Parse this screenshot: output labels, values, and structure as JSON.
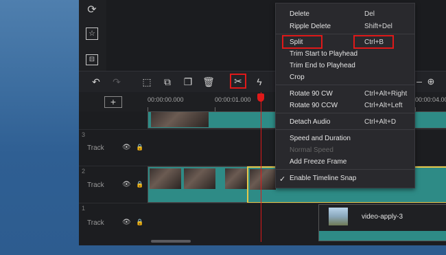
{
  "left_panel": {
    "icons": [
      "refresh-icon",
      "sticker-icon",
      "layout-icon"
    ]
  },
  "toolbar": {
    "buttons": [
      "undo-icon",
      "redo-icon",
      "crop-frame-icon",
      "copy-icon",
      "duplicate-icon",
      "delete-icon",
      "scissors-icon",
      "flash-icon",
      "zoom-in-icon"
    ]
  },
  "ruler": {
    "add_label": "+",
    "times": [
      "00:00:00.000",
      "00:00:01.000",
      "00:00:04.00"
    ]
  },
  "tracks": [
    {
      "number": "3",
      "label": "Track"
    },
    {
      "number": "2",
      "label": "Track"
    },
    {
      "number": "1",
      "label": "Track"
    }
  ],
  "clip_names": {
    "track1": "video-apply-3"
  },
  "context_menu": {
    "items": [
      {
        "label": "Delete",
        "shortcut": "Del"
      },
      {
        "label": "Ripple Delete",
        "shortcut": "Shift+Del"
      },
      {
        "label": "Split",
        "shortcut": "Ctrl+B"
      },
      {
        "label": "Trim Start to Playhead",
        "shortcut": ""
      },
      {
        "label": "Trim End to Playhead",
        "shortcut": ""
      },
      {
        "label": "Crop",
        "shortcut": ""
      },
      {
        "label": "Rotate 90 CW",
        "shortcut": "Ctrl+Alt+Right"
      },
      {
        "label": "Rotate 90 CCW",
        "shortcut": "Ctrl+Alt+Left"
      },
      {
        "label": "Detach Audio",
        "shortcut": "Ctrl+Alt+D"
      },
      {
        "label": "Speed and Duration",
        "shortcut": ""
      },
      {
        "label": "Normal Speed",
        "shortcut": ""
      },
      {
        "label": "Add Freeze Frame",
        "shortcut": ""
      },
      {
        "label": "Enable Timeline Snap",
        "shortcut": "",
        "checked": "✓"
      }
    ]
  },
  "colors": {
    "accent_red": "#e01919",
    "clip_teal": "#2e8b86",
    "selected_yellow": "#e7c84a"
  }
}
